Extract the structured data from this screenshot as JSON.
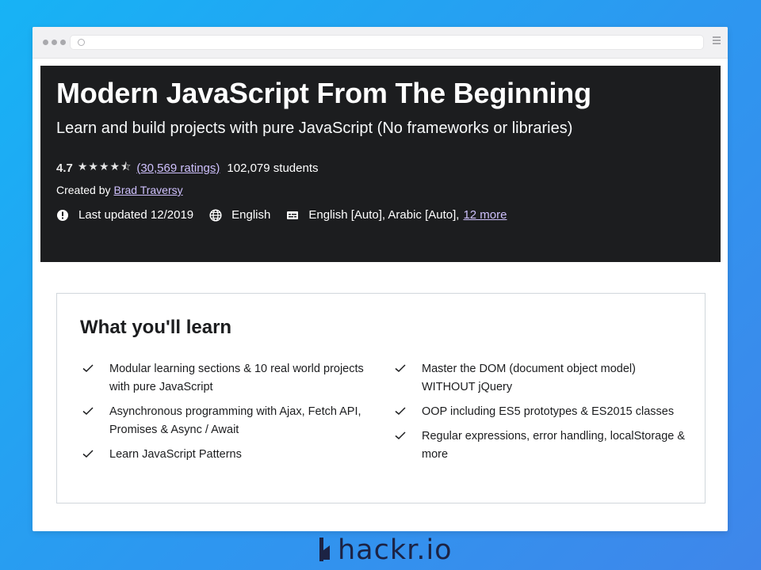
{
  "course": {
    "title": "Modern JavaScript From The Beginning",
    "subtitle": "Learn and build projects with pure JavaScript (No frameworks or libraries)",
    "rating_value": "4.7",
    "stars": "★★★★⯪",
    "ratings_link": "(30,569 ratings)",
    "students": "102,079 students",
    "created_by_label": "Created by",
    "author": "Brad Traversy",
    "last_updated": "Last updated 12/2019",
    "language": "English",
    "captions": "English [Auto], Arabic [Auto],",
    "captions_more": "12 more"
  },
  "learn": {
    "heading": "What you'll learn",
    "left_items": [
      "Modular learning sections & 10 real world projects with pure JavaScript",
      "Asynchronous programming with Ajax, Fetch API, Promises & Async / Await",
      "Learn JavaScript Patterns"
    ],
    "right_items": [
      "Master the DOM (document object model) WITHOUT jQuery",
      "OOP including ES5 prototypes & ES2015 classes",
      "Regular expressions, error handling, localStorage & more"
    ]
  },
  "brand": {
    "name": "hackr.io"
  },
  "icons": {
    "alert": "alert-icon",
    "globe": "globe-icon",
    "captions": "closed-captions-icon",
    "check": "check-icon",
    "menu": "hamburger-menu-icon"
  },
  "colors": {
    "hero_bg": "#1c1d1f",
    "link_purple": "#cec0fc",
    "page_gradient_start": "#17b3f5",
    "page_gradient_end": "#3f86ea"
  }
}
